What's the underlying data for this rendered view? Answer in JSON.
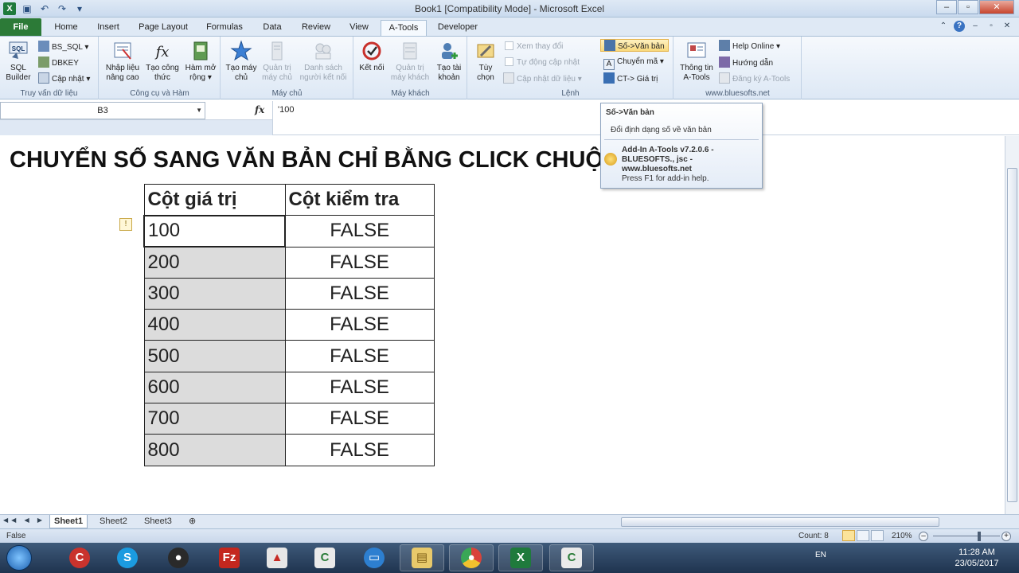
{
  "window": {
    "title": "Book1  [Compatibility Mode]  -  Microsoft Excel",
    "controls": [
      "–",
      "▫",
      "✕"
    ]
  },
  "ribbon_tabs": [
    "File",
    "Home",
    "Insert",
    "Page Layout",
    "Formulas",
    "Data",
    "Review",
    "View",
    "A-Tools",
    "Developer"
  ],
  "active_tab": "A-Tools",
  "ribbon": {
    "g1": {
      "label": "Truy vấn dữ liệu",
      "sql_builder": "SQL Builder",
      "bs_sql": "BS_SQL",
      "dbkey": "DBKEY",
      "cap_nhat": "Cập nhật"
    },
    "g2": {
      "label": "Công cụ và Hàm",
      "nhap_lieu": "Nhập liệu nâng cao",
      "tao_cong_thuc": "Tạo công thức",
      "ham_mo_rong": "Hàm mở rộng"
    },
    "g3": {
      "label": "Máy chủ",
      "tao_may_chu": "Tạo máy chủ",
      "quan_tri_may_chu": "Quản trị máy chủ",
      "danh_sach": "Danh sách người kết nối"
    },
    "g4": {
      "label": "Máy khách",
      "ket_noi": "Kết nối",
      "quan_tri_may_khach": "Quản trị máy khách",
      "tao_tai_khoan": "Tạo tài khoản"
    },
    "g5": {
      "label": "Lệnh",
      "tuy_chon": "Tùy chọn",
      "xem_thay_doi": "Xem thay đổi",
      "tu_dong": "Tự động cập nhật",
      "cap_nhat_du_lieu": "Cập nhật dữ liệu",
      "so_van_ban": "Số->Văn bản",
      "chuyen_ma": "Chuyển mã",
      "ct_gia_tri": "CT-> Giá trị"
    },
    "g6": {
      "label": "www.bluesofts.net",
      "thong_tin": "Thông tin A-Tools",
      "help_online": "Help Online",
      "huong_dan": "Hướng dẫn",
      "dang_ky": "Đăng ký A-Tools"
    }
  },
  "formula_bar": {
    "name_box": "B3",
    "fx": "fx",
    "content": "'100"
  },
  "tooltip": {
    "title": "Số->Văn bản",
    "description": "Đổi định dạng số về văn bản",
    "line1": "Add-In A-Tools v7.2.0.6 -",
    "line2": "BLUESOFTS., jsc -",
    "line3": "www.bluesofts.net",
    "line4": "Press F1 for add-in help."
  },
  "sheet": {
    "headline": "CHUYỂN SỐ SANG VĂN BẢN CHỈ BẰNG CLICK CHUỘT",
    "headers": [
      "Cột giá trị",
      "Cột kiểm tra"
    ],
    "rows": [
      [
        "100",
        "FALSE"
      ],
      [
        "200",
        "FALSE"
      ],
      [
        "300",
        "FALSE"
      ],
      [
        "400",
        "FALSE"
      ],
      [
        "500",
        "FALSE"
      ],
      [
        "600",
        "FALSE"
      ],
      [
        "700",
        "FALSE"
      ],
      [
        "800",
        "FALSE"
      ]
    ]
  },
  "sheet_tabs": [
    "Sheet1",
    "Sheet2",
    "Sheet3"
  ],
  "active_sheet": "Sheet1",
  "status_bar": {
    "left": "False",
    "count": "Count: 8",
    "zoom": "210%"
  },
  "taskbar": {
    "lang": "EN",
    "time": "11:28 AM",
    "date": "23/05/2017"
  }
}
